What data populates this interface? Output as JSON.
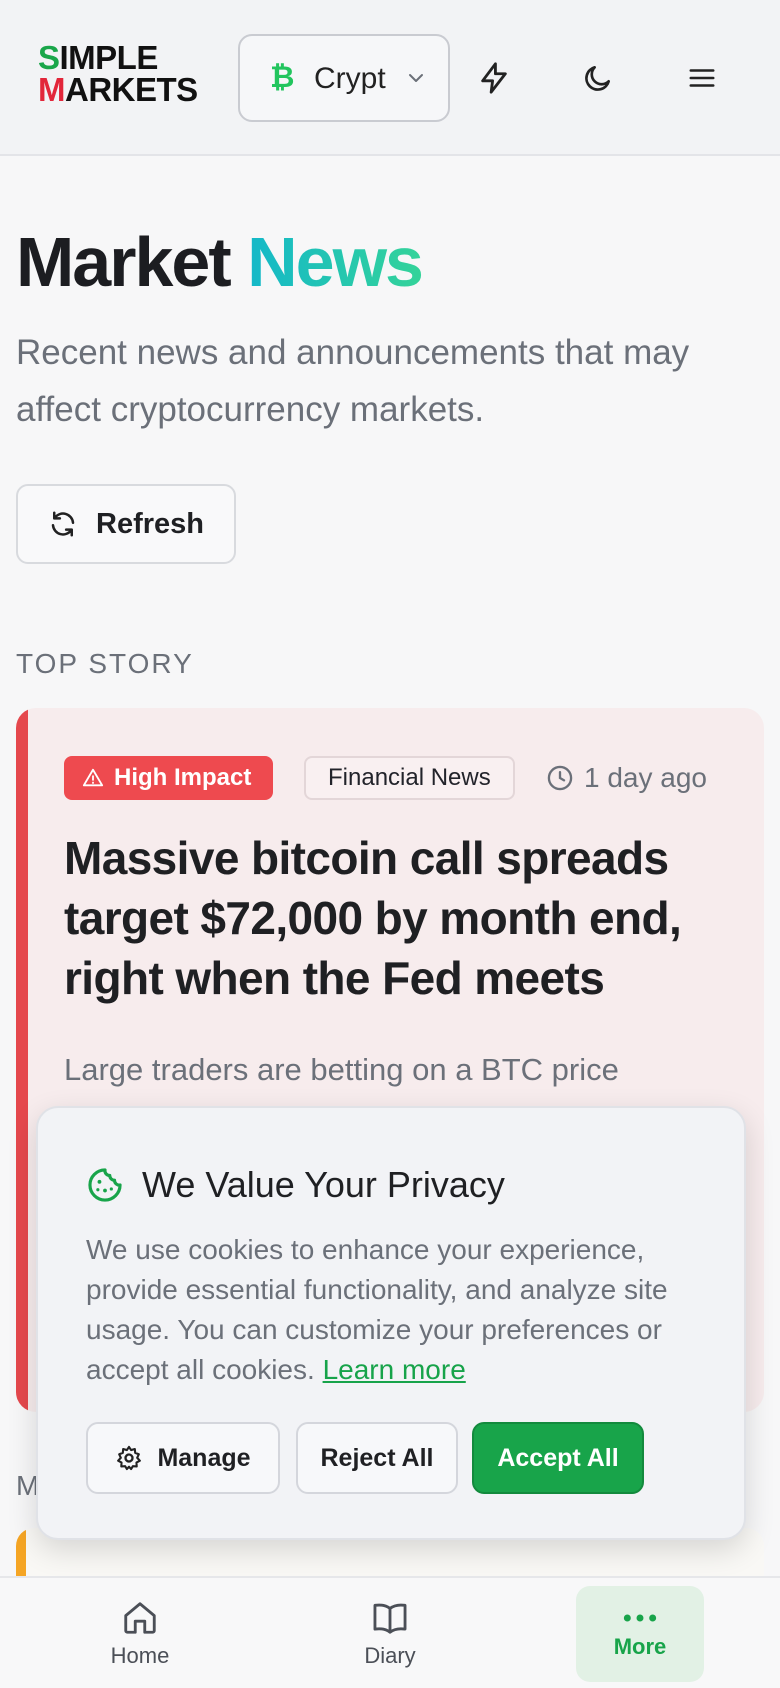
{
  "header": {
    "logo_line1_first": "S",
    "logo_line1_rest": "IMPLE",
    "logo_line2_first": "M",
    "logo_line2_rest": "ARKETS",
    "asset_selector": {
      "icon": "bitcoin-icon",
      "label": "Crypt"
    },
    "icons": [
      "lightning-icon",
      "moon-icon",
      "menu-icon"
    ]
  },
  "main": {
    "title_part1": "Market ",
    "title_part2": "News",
    "subtitle": "Recent news and announcements that may affect cryptocurrency markets.",
    "refresh_label": "Refresh",
    "top_story_label": "TOP STORY",
    "more_label_partial": "M"
  },
  "top_story": {
    "impact_badge": "High Impact",
    "category": "Financial News",
    "time_ago": "1 day ago",
    "headline": "Massive bitcoin call spreads target $72,000 by month end, right when the Fed meets",
    "excerpt": "Large traders are betting on a BTC price"
  },
  "cookie_banner": {
    "title": "We Value Your Privacy",
    "body": "We use cookies to enhance your experience, provide essential functionality, and analyze site usage. You can customize your preferences or accept all cookies.",
    "learn_more": "Learn more",
    "manage_label": "Manage",
    "reject_label": "Reject All",
    "accept_label": "Accept All"
  },
  "bottom_nav": {
    "home": "Home",
    "diary": "Diary",
    "more": "More"
  },
  "colors": {
    "brand_green": "#18a44a",
    "impact_red": "#ee4a4f",
    "accent_teal": "#14b8c9",
    "card_bg": "#f7eced"
  }
}
